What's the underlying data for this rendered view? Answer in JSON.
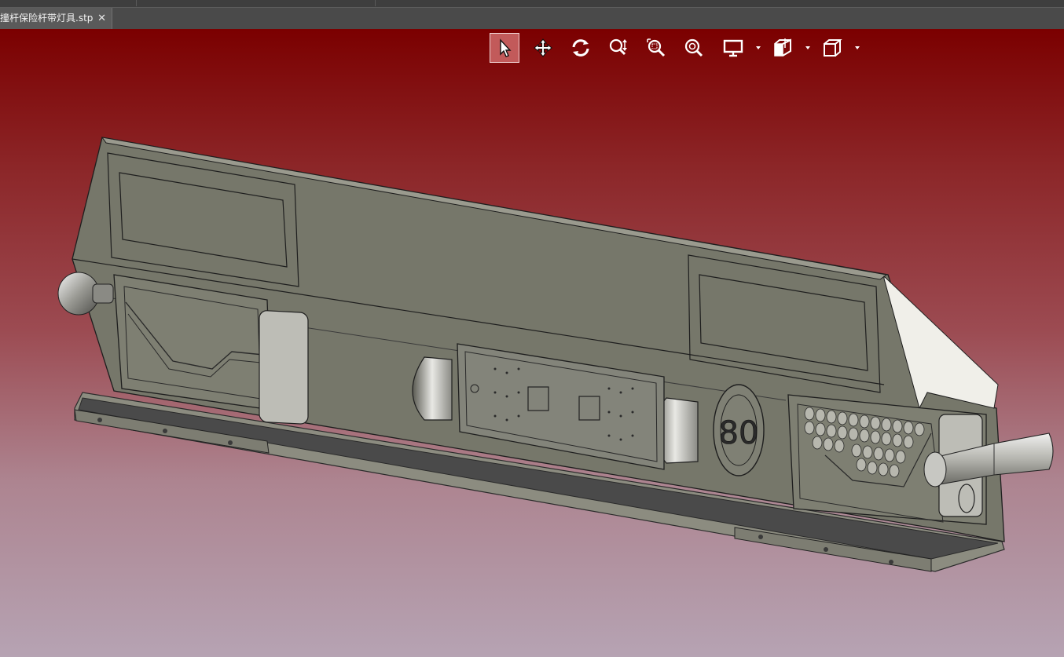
{
  "tab": {
    "title": "撞杆保险杆带灯具.stp",
    "close_glyph": "✕"
  },
  "toolbar": {
    "buttons": [
      {
        "name": "select-button",
        "icon": "cursor-arrow-icon",
        "active": true
      },
      {
        "name": "pan-button",
        "icon": "move-arrows-icon"
      },
      {
        "name": "rotate-button",
        "icon": "rotate-icon"
      },
      {
        "name": "zoom-button",
        "icon": "zoom-updown-icon"
      },
      {
        "name": "zoom-window-button",
        "icon": "zoom-window-icon"
      },
      {
        "name": "zoom-fit-button",
        "icon": "zoom-fit-icon"
      },
      {
        "name": "display-mode-button",
        "icon": "monitor-icon",
        "dropdown": true
      },
      {
        "name": "section-view-button",
        "icon": "section-cube-icon",
        "dropdown": true
      },
      {
        "name": "view-orientation-button",
        "icon": "cube-icon",
        "dropdown": true
      }
    ]
  },
  "model": {
    "badge_number": "80"
  },
  "colors": {
    "viewport_top": "#7b0000",
    "viewport_bottom": "#b6a3b3",
    "part_gray": "#7a7a6a",
    "active_button": "#c25a5a"
  }
}
